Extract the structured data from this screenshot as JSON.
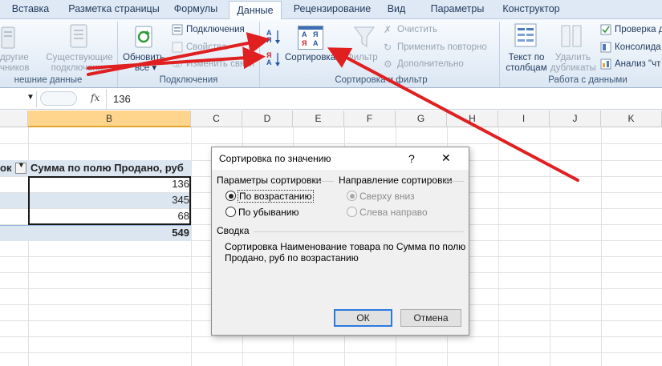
{
  "ribbon": {
    "tabs": [
      {
        "label": "Вставка",
        "active": false
      },
      {
        "label": "Разметка страницы",
        "active": false
      },
      {
        "label": "Формулы",
        "active": false
      },
      {
        "label": "Данные",
        "active": true
      },
      {
        "label": "Рецензирование",
        "active": false
      },
      {
        "label": "Вид",
        "active": false
      },
      {
        "label": "Параметры",
        "active": false
      },
      {
        "label": "Конструктор",
        "active": false
      }
    ],
    "get_external": {
      "from_other_l1": "другие",
      "from_other_l2": "чников",
      "existing_l1": "Существующие",
      "existing_l2": "подключения",
      "group_label": "нешние данные"
    },
    "connections": {
      "refresh_l1": "Обновить",
      "refresh_l2": "все",
      "connections": "Подключения",
      "properties": "Свойства",
      "edit_links": "Изменить связи",
      "group_label": "Подключения"
    },
    "sort_filter": {
      "sort_az_glyph_top": "А",
      "sort_az_glyph_bottom": "Я",
      "sort_za_glyph_top": "Я",
      "sort_za_glyph_bottom": "А",
      "sort_dialog_glyphs": [
        "А",
        "Я",
        "Я",
        "А"
      ],
      "sort": "Сортировка",
      "filter": "Фильтр",
      "clear": "Очистить",
      "reapply": "Применить повторно",
      "advanced": "Дополнительно",
      "group_label": "Сортировка и фильтр"
    },
    "data_tools": {
      "text_to_cols_l1": "Текст по",
      "text_to_cols_l2": "столбцам",
      "remove_dup_l1": "Удалить",
      "remove_dup_l2": "дубликаты",
      "validation": "Проверка д",
      "consolidate": "Консолида",
      "what_if": "Анализ \"чт",
      "group_label": "Работа с данными"
    }
  },
  "formula_bar": {
    "fx": "fx",
    "value": "136"
  },
  "grid": {
    "columns": [
      "B",
      "C",
      "D",
      "E",
      "F",
      "G",
      "H",
      "I",
      "J",
      "K"
    ],
    "selected_column": "B",
    "header_a": "ок",
    "header_b": "Сумма по полю Продано, руб",
    "values": [
      "136",
      "345",
      "68"
    ],
    "total": "549"
  },
  "dialog": {
    "title": "Сортировка по значению",
    "help": "?",
    "close": "✕",
    "options_label": "Параметры сортировки",
    "ascending": "По возрастанию",
    "descending": "По убыванию",
    "direction_label": "Направление сортировки",
    "top_to_bottom": "Сверху вниз",
    "left_to_right": "Слева направо",
    "summary_label": "Сводка",
    "summary_text_l1": "Сортировка Наименование товара по Сумма по полю",
    "summary_text_l2": "Продано, руб по возрастанию",
    "ok": "ОК",
    "cancel": "Отмена",
    "ascending_selected": true
  },
  "colors": {
    "arrow": "#e02020",
    "selection_fill": "#ffd58d",
    "ribbon_text": "#1e395b",
    "default_button_border": "#2a7be0"
  }
}
